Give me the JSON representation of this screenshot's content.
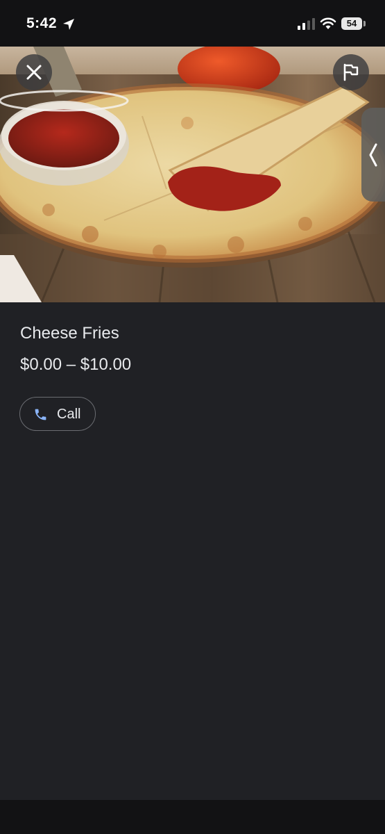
{
  "status_bar": {
    "time": "5:42",
    "battery_level": "54",
    "icons": [
      "location-arrow-icon",
      "cellular-signal-icon",
      "wifi-icon",
      "battery-icon"
    ]
  },
  "photo": {
    "icon_names": [
      "close-icon",
      "flag-icon",
      "chevron-left-icon"
    ]
  },
  "place": {
    "name": "Cheese Fries",
    "price_range": "$0.00 – $10.00"
  },
  "actions": {
    "call_label": "Call",
    "call_icon": "phone-icon"
  },
  "colors": {
    "background": "#202125",
    "status_bar": "#121214",
    "text": "#e8eaed",
    "accent_blue": "#8ab4f8",
    "button_border": "#6b6d72"
  }
}
